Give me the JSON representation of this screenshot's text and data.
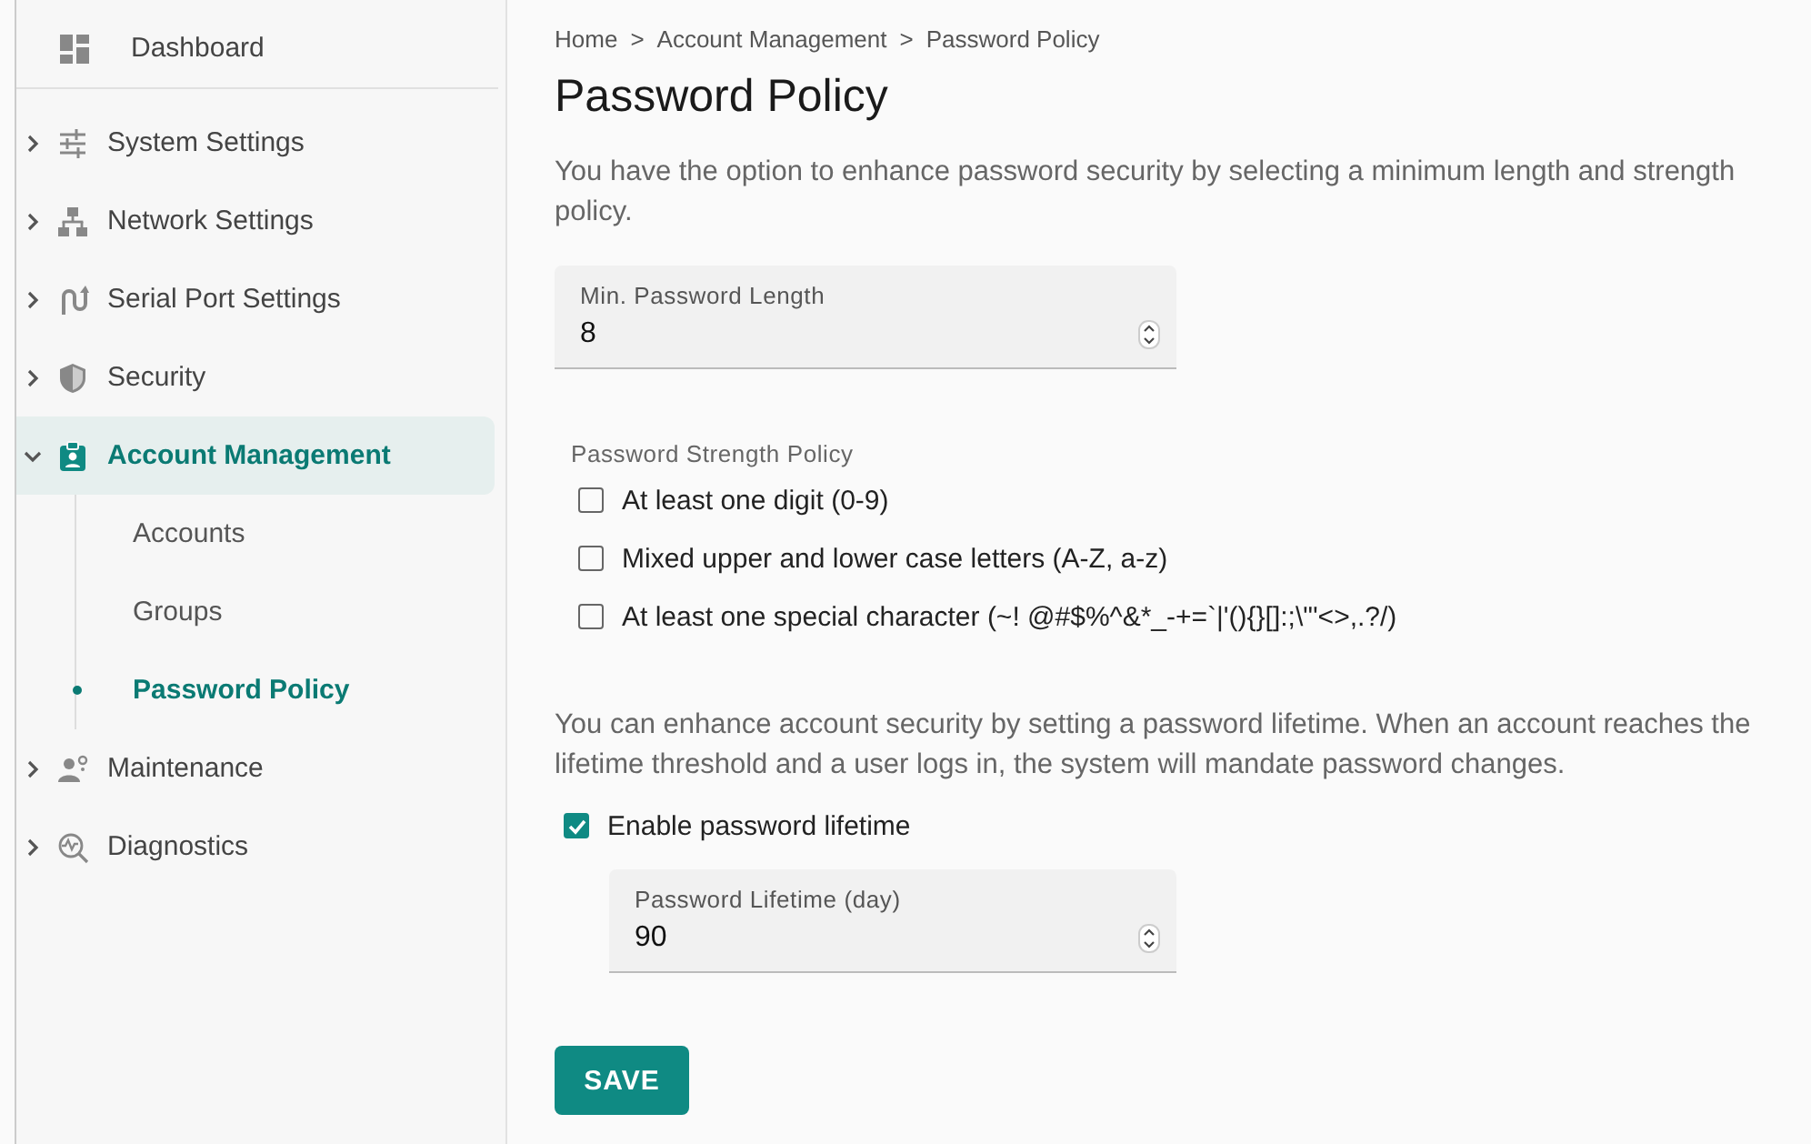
{
  "sidebar": {
    "top_item": {
      "label": "Dashboard",
      "selected": false
    },
    "items": [
      {
        "label": "System Settings",
        "expanded": false,
        "selected": false
      },
      {
        "label": "Network Settings",
        "expanded": false,
        "selected": false
      },
      {
        "label": "Serial Port Settings",
        "expanded": false,
        "selected": false
      },
      {
        "label": "Security",
        "expanded": false,
        "selected": false
      },
      {
        "label": "Account Management",
        "expanded": true,
        "selected": true,
        "children": [
          {
            "label": "Accounts",
            "selected": false
          },
          {
            "label": "Groups",
            "selected": false
          },
          {
            "label": "Password Policy",
            "selected": true
          }
        ]
      },
      {
        "label": "Maintenance",
        "expanded": false,
        "selected": false
      },
      {
        "label": "Diagnostics",
        "expanded": false,
        "selected": false
      }
    ]
  },
  "breadcrumb": [
    "Home",
    "Account Management",
    "Password Policy"
  ],
  "breadcrumb_separator": ">",
  "title": "Password Policy",
  "intro": "You have the option to enhance password security by selecting a minimum length and strength policy.",
  "min_length_field": {
    "label": "Min. Password Length",
    "value": "8"
  },
  "strength_policy": {
    "label": "Password Strength Policy",
    "options": [
      {
        "label": "At least one digit (0-9)",
        "checked": false
      },
      {
        "label": "Mixed upper and lower case letters (A-Z, a-z)",
        "checked": false
      },
      {
        "label": "At least one special character (~! @#$%^&*_-+=`|'(){}[]:;\\\"'<>,.?/)",
        "checked": false
      }
    ]
  },
  "lifetime_text": "You can enhance account security by setting a password lifetime. When an account reaches the lifetime threshold and a user logs in, the system will mandate password changes.",
  "lifetime_toggle": {
    "label": "Enable password lifetime",
    "checked": true
  },
  "lifetime_field": {
    "label": "Password Lifetime (day)",
    "value": "90"
  },
  "save_button": "SAVE"
}
